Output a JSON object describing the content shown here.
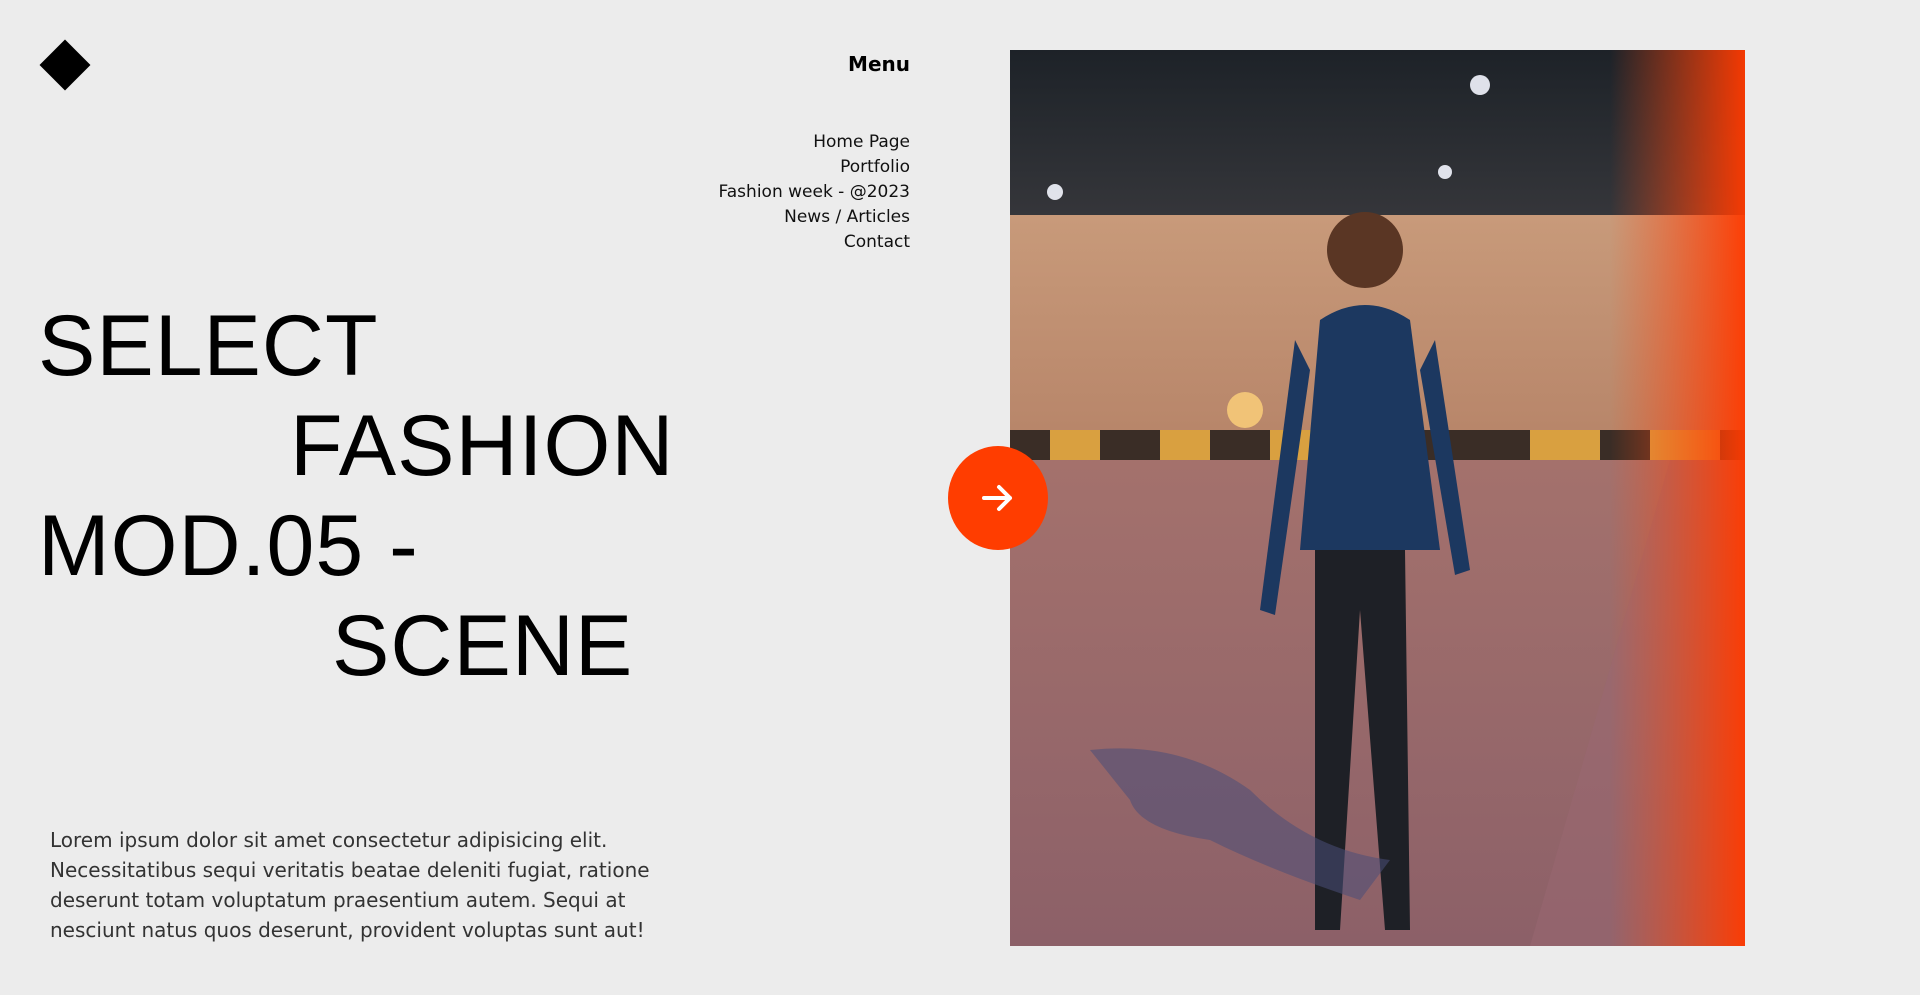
{
  "header": {
    "logo_icon": "diamond-icon",
    "menu_label": "Menu"
  },
  "nav": {
    "items": [
      {
        "label": "Home Page"
      },
      {
        "label": "Portfolio"
      },
      {
        "label": "Fashion week - @2023"
      },
      {
        "label": "News / Articles"
      },
      {
        "label": "Contact"
      }
    ]
  },
  "hero": {
    "lines": [
      "SELECT",
      "FASHION",
      "MOD.05 -",
      "SCENE"
    ],
    "description": "Lorem ipsum dolor sit amet consectetur adipisicing elit. Necessitatibus sequi veritatis beatae deleniti fugiat, ratione deserunt totam voluptatum praesentium autem. Sequi at nesciunt natus quos deserunt, provident voluptas sunt aut!"
  },
  "media": {
    "arrow_icon": "arrow-right-icon",
    "accent_color": "#ff3d00"
  }
}
